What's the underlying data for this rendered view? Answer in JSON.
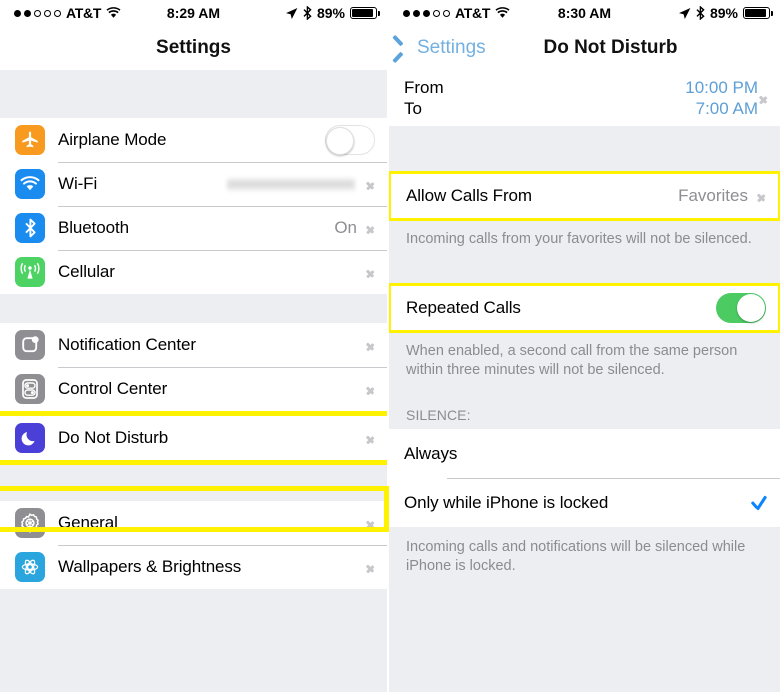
{
  "left": {
    "status": {
      "carrier": "AT&T",
      "signal_dots_filled": 2,
      "signal_dots_total": 5,
      "wifi_icon": "wifi-icon",
      "time": "8:29 AM",
      "location_icon": "location-arrow-icon",
      "bluetooth_icon": "bluetooth-icon",
      "battery_percent": "89%"
    },
    "nav": {
      "title": "Settings"
    },
    "groups": [
      {
        "rows": [
          {
            "icon": "airplane-icon",
            "icon_color": "#f79a1f",
            "label": "Airplane Mode",
            "control": "toggle",
            "toggle_on": false
          },
          {
            "icon": "wifi-icon",
            "icon_color": "#1a8cf0",
            "label": "Wi-Fi",
            "control": "blurred-value",
            "chevron": true
          },
          {
            "icon": "bluetooth-icon",
            "icon_color": "#1a8cf0",
            "label": "Bluetooth",
            "value": "On",
            "chevron": true
          },
          {
            "icon": "cellular-icon",
            "icon_color": "#4cd363",
            "label": "Cellular",
            "value": "",
            "chevron": true
          }
        ]
      },
      {
        "rows": [
          {
            "icon": "notification-center-icon",
            "icon_color": "#8e8e93",
            "label": "Notification Center",
            "value": "",
            "chevron": true
          },
          {
            "icon": "control-center-icon",
            "icon_color": "#8e8e93",
            "label": "Control Center",
            "value": "",
            "chevron": true
          },
          {
            "icon": "moon-icon",
            "icon_color": "#4a3fd6",
            "label": "Do Not Disturb",
            "value": "",
            "chevron": true,
            "highlighted": true
          }
        ]
      },
      {
        "rows": [
          {
            "icon": "gear-icon",
            "icon_color": "#8e8e93",
            "label": "General",
            "value": "",
            "chevron": true
          },
          {
            "icon": "wallpaper-icon",
            "icon_color": "#2aa5dd",
            "label": "Wallpapers & Brightness",
            "value": "",
            "chevron": true
          }
        ]
      }
    ]
  },
  "right": {
    "status": {
      "carrier": "AT&T",
      "signal_dots_filled": 3,
      "signal_dots_total": 5,
      "time": "8:30 AM",
      "battery_percent": "89%"
    },
    "nav": {
      "back_label": "Settings",
      "title": "Do Not Disturb"
    },
    "schedule": {
      "from_label": "From",
      "from_value": "10:00 PM",
      "to_label": "To",
      "to_value": "7:00 AM"
    },
    "allow_calls": {
      "label": "Allow Calls From",
      "value": "Favorites",
      "footnote": "Incoming calls from your favorites will not be silenced."
    },
    "repeated_calls": {
      "label": "Repeated Calls",
      "toggle_on": true,
      "footnote": "When enabled, a second call from the same person within three minutes will not be silenced."
    },
    "silence": {
      "header": "SILENCE:",
      "options": [
        {
          "label": "Always",
          "selected": false
        },
        {
          "label": "Only while iPhone is locked",
          "selected": true
        }
      ],
      "footnote": "Incoming calls and notifications will be silenced while iPhone is locked."
    }
  },
  "colors": {
    "highlight": "#fff200",
    "toggle_on": "#4ccb63",
    "tint_blue": "#5d9fd6",
    "check_blue": "#0b84ff"
  }
}
